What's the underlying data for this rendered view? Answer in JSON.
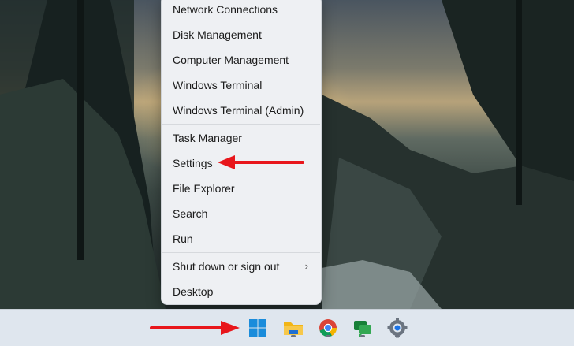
{
  "context_menu": {
    "items_group1": [
      "Network Connections",
      "Disk Management",
      "Computer Management",
      "Windows Terminal",
      "Windows Terminal (Admin)"
    ],
    "items_group2": [
      "Task Manager",
      "Settings",
      "File Explorer",
      "Search",
      "Run"
    ],
    "items_group3": [
      "Shut down or sign out",
      "Desktop"
    ],
    "submenu_chevron": "›"
  },
  "taskbar": {
    "icons": [
      "start-button",
      "file-explorer",
      "chrome",
      "google-chat",
      "settings-gear"
    ]
  },
  "colors": {
    "annotation_arrow": "#e8161b",
    "windows_blue": "#1a8cdb",
    "folder_yellow": "#f2b516"
  }
}
